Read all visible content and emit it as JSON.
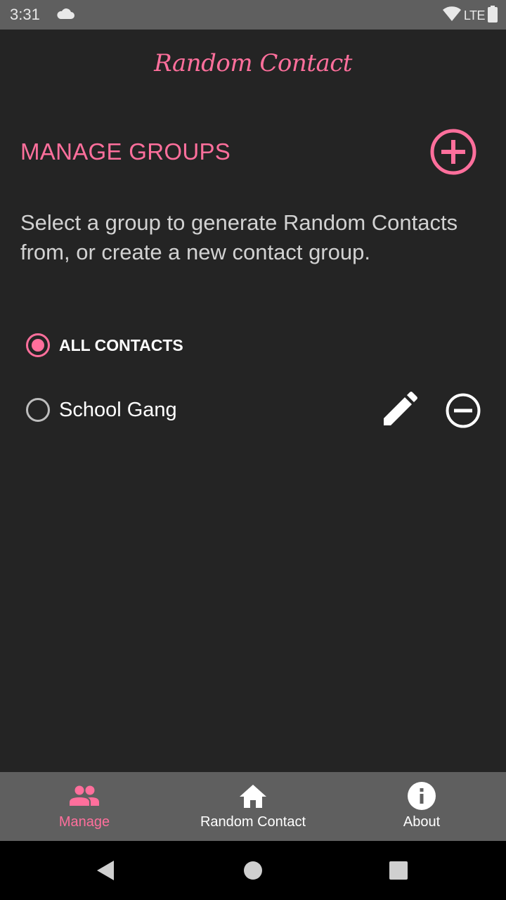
{
  "status_bar": {
    "time": "3:31",
    "network": "LTE"
  },
  "app": {
    "title": "Random Contact"
  },
  "section": {
    "title": "MANAGE GROUPS",
    "description": "Select a group to generate Random Contacts from, or create a new contact group."
  },
  "groups": [
    {
      "label": "ALL CONTACTS",
      "selected": true
    },
    {
      "label": "School Gang",
      "selected": false
    }
  ],
  "bottom_nav": {
    "items": [
      {
        "label": "Manage",
        "icon": "people-icon",
        "active": true
      },
      {
        "label": "Random Contact",
        "icon": "home-icon",
        "active": false
      },
      {
        "label": "About",
        "icon": "info-icon",
        "active": false
      }
    ]
  },
  "colors": {
    "accent": "#ff6f9c",
    "background": "#242424",
    "bar": "#5f5f5f"
  }
}
